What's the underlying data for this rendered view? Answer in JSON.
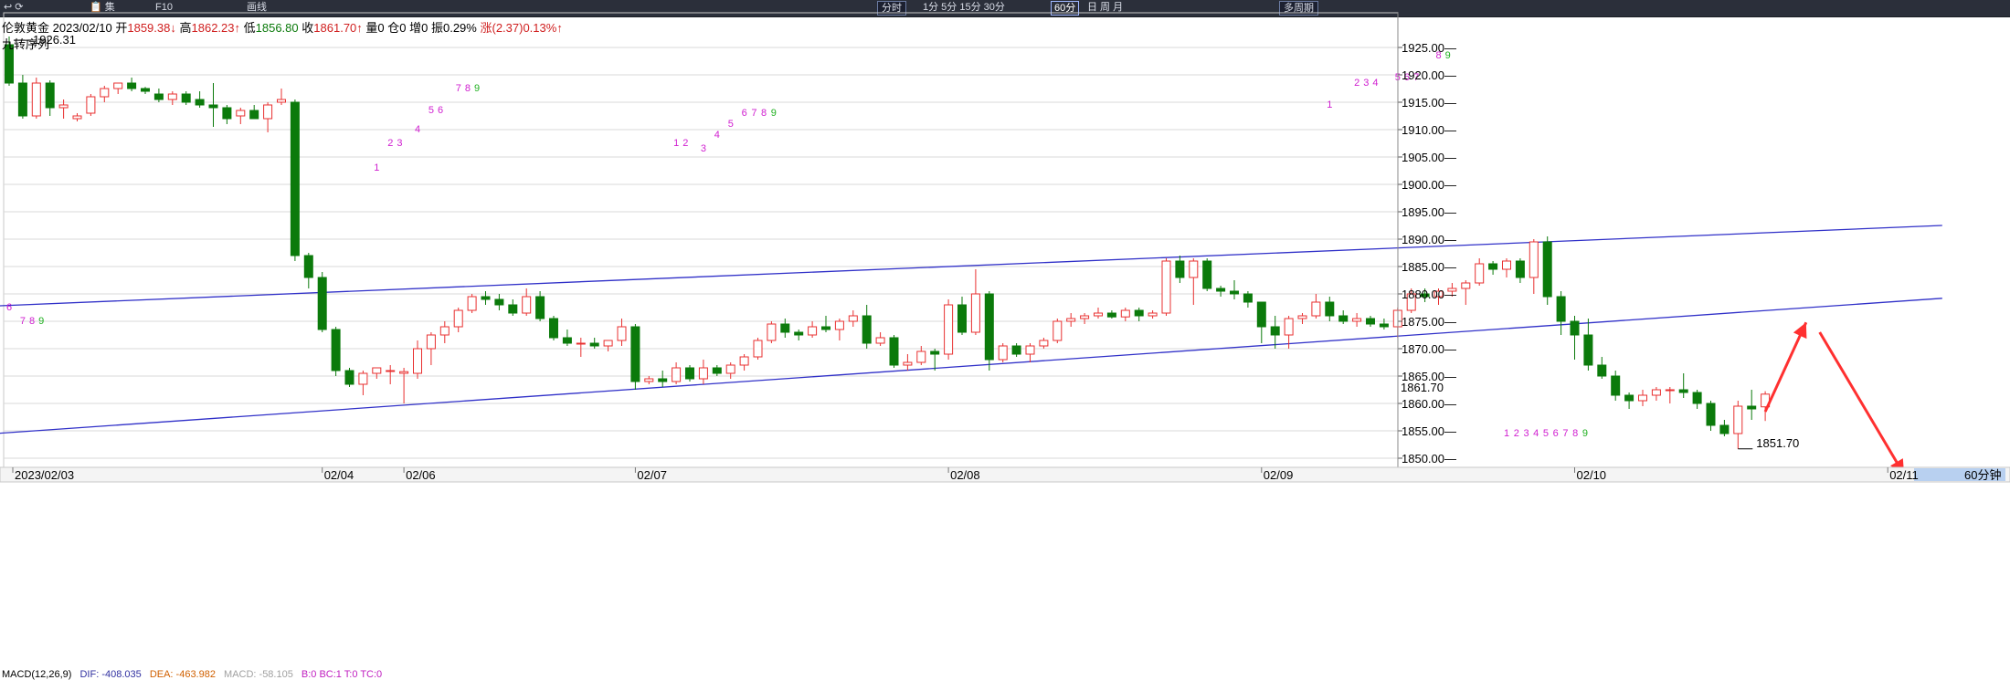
{
  "toolbar": {
    "items": [
      {
        "label": "↩ ⟳",
        "x": 4
      },
      {
        "label": "📋 集",
        "x": 98
      },
      {
        "label": "F10",
        "x": 170
      },
      {
        "label": "画线",
        "x": 270
      },
      {
        "label": "分时",
        "x": 960,
        "box": true
      },
      {
        "label": "1分 5分 15分 30分",
        "x": 1010
      },
      {
        "label": "60分",
        "x": 1150,
        "selected": true
      },
      {
        "label": "日 周 月",
        "x": 1190
      },
      {
        "label": "多周期",
        "x": 1400,
        "box": true
      }
    ]
  },
  "info": {
    "name": "伦敦黄金",
    "date": "2023/02/10",
    "open_label": "开",
    "open": "1859.38",
    "high_label": "高",
    "high": "1862.23",
    "low_label": "低",
    "low": "1856.80",
    "close_label": "收",
    "close": "1861.70",
    "vol": "量0",
    "oi": "仓0",
    "inc": "增0",
    "amp": "振0.29%",
    "chg": "涨(2.37)0.13%"
  },
  "indicator_name": "九转序列",
  "macd": {
    "params": "MACD(12,26,9)",
    "dif": "DIF: -408.035",
    "dea": "DEA: -463.982",
    "macd": "MACD: -58.105",
    "extra": "B:0  BC:1  T:0  TC:0"
  },
  "period_label": "60分钟",
  "colors": {
    "up": "#e83030",
    "down": "#0b7a0b",
    "trend_line": "#3030c8",
    "arrow": "#ff3030",
    "seq_magenta": "#d020d0",
    "seq_green": "#20b020"
  },
  "chart_data": {
    "type": "candlestick",
    "symbol": "伦敦黄金",
    "ylim": [
      1849,
      1930
    ],
    "y_ticks": [
      1850,
      1855,
      1860,
      1865,
      1870,
      1875,
      1880,
      1885,
      1890,
      1895,
      1900,
      1905,
      1910,
      1915,
      1920,
      1925
    ],
    "x_labels": [
      {
        "label": "2023/02/03",
        "bar": 0
      },
      {
        "label": "02/04",
        "bar": 23
      },
      {
        "label": "02/06",
        "bar": 29
      },
      {
        "label": "02/07",
        "bar": 46
      },
      {
        "label": "02/08",
        "bar": 69
      },
      {
        "label": "02/09",
        "bar": 92
      },
      {
        "label": "02/10",
        "bar": 115
      },
      {
        "label": "02/11",
        "bar": 138
      }
    ],
    "bar_count_total": 142,
    "candles": [
      [
        1925.5,
        1927.0,
        1918.0,
        1918.5
      ],
      [
        1918.5,
        1920.0,
        1912.0,
        1912.5
      ],
      [
        1912.5,
        1919.5,
        1912.0,
        1918.5
      ],
      [
        1918.5,
        1919.0,
        1912.5,
        1914.0
      ],
      [
        1914.0,
        1915.5,
        1912.0,
        1914.5
      ],
      [
        1912.0,
        1913.0,
        1911.5,
        1912.5
      ],
      [
        1913.0,
        1916.5,
        1912.5,
        1916.0
      ],
      [
        1916.0,
        1918.0,
        1915.0,
        1917.5
      ],
      [
        1917.5,
        1918.5,
        1916.5,
        1918.5
      ],
      [
        1918.5,
        1919.5,
        1917.0,
        1917.5
      ],
      [
        1917.5,
        1917.8,
        1916.5,
        1917.0
      ],
      [
        1916.5,
        1917.5,
        1915.0,
        1915.5
      ],
      [
        1915.5,
        1917.0,
        1914.5,
        1916.5
      ],
      [
        1916.5,
        1917.0,
        1914.5,
        1915.0
      ],
      [
        1915.5,
        1917.0,
        1914.0,
        1914.5
      ],
      [
        1914.5,
        1918.5,
        1910.5,
        1914.0
      ],
      [
        1914.0,
        1914.5,
        1911.0,
        1912.0
      ],
      [
        1912.5,
        1914.0,
        1911.0,
        1913.5
      ],
      [
        1913.5,
        1914.5,
        1912.5,
        1912.0
      ],
      [
        1912.0,
        1915.0,
        1909.5,
        1914.5
      ],
      [
        1915.0,
        1917.5,
        1914.5,
        1915.5
      ],
      [
        1915.0,
        1915.5,
        1886.0,
        1887.0
      ],
      [
        1887.0,
        1887.5,
        1881.0,
        1883.0
      ],
      [
        1883.0,
        1884.0,
        1873.0,
        1873.5
      ],
      [
        1873.5,
        1874.0,
        1865.0,
        1866.0
      ],
      [
        1866.0,
        1866.5,
        1863.0,
        1863.5
      ],
      [
        1863.5,
        1866.0,
        1861.5,
        1865.5
      ],
      [
        1865.5,
        1866.5,
        1864.5,
        1866.5
      ],
      [
        1866.0,
        1867.0,
        1863.5,
        1866.0
      ],
      [
        1865.5,
        1866.5,
        1860.0,
        1865.8
      ],
      [
        1865.5,
        1871.5,
        1864.5,
        1870.0
      ],
      [
        1870.0,
        1873.0,
        1867.0,
        1872.5
      ],
      [
        1872.5,
        1875.0,
        1871.0,
        1874.0
      ],
      [
        1874.0,
        1877.5,
        1873.0,
        1877.0
      ],
      [
        1877.0,
        1880.0,
        1876.5,
        1879.5
      ],
      [
        1879.5,
        1880.5,
        1878.0,
        1879.0
      ],
      [
        1879.0,
        1880.0,
        1877.0,
        1878.0
      ],
      [
        1878.0,
        1879.0,
        1876.0,
        1876.5
      ],
      [
        1876.5,
        1881.0,
        1876.0,
        1879.5
      ],
      [
        1879.5,
        1880.5,
        1875.0,
        1875.5
      ],
      [
        1875.5,
        1876.0,
        1871.5,
        1872.0
      ],
      [
        1872.0,
        1873.5,
        1870.5,
        1871.0
      ],
      [
        1871.0,
        1872.0,
        1868.5,
        1871.0
      ],
      [
        1871.0,
        1872.0,
        1870.0,
        1870.5
      ],
      [
        1870.5,
        1871.5,
        1869.5,
        1871.5
      ],
      [
        1871.5,
        1875.5,
        1870.5,
        1874.0
      ],
      [
        1874.0,
        1874.5,
        1862.5,
        1864.0
      ],
      [
        1864.0,
        1865.0,
        1863.5,
        1864.5
      ],
      [
        1864.5,
        1866.0,
        1863.0,
        1864.0
      ],
      [
        1864.0,
        1867.5,
        1863.5,
        1866.5
      ],
      [
        1866.5,
        1867.0,
        1864.0,
        1864.5
      ],
      [
        1864.5,
        1868.0,
        1863.5,
        1866.5
      ],
      [
        1866.5,
        1867.0,
        1865.0,
        1865.5
      ],
      [
        1865.5,
        1867.5,
        1864.5,
        1867.0
      ],
      [
        1867.0,
        1869.0,
        1866.0,
        1868.5
      ],
      [
        1868.5,
        1872.0,
        1868.0,
        1871.5
      ],
      [
        1871.5,
        1875.0,
        1871.0,
        1874.5
      ],
      [
        1874.5,
        1875.5,
        1872.0,
        1873.0
      ],
      [
        1873.0,
        1873.5,
        1871.5,
        1872.5
      ],
      [
        1872.5,
        1875.0,
        1872.0,
        1874.0
      ],
      [
        1874.0,
        1876.0,
        1873.0,
        1873.5
      ],
      [
        1873.5,
        1875.5,
        1871.5,
        1875.0
      ],
      [
        1875.0,
        1877.0,
        1874.0,
        1876.0
      ],
      [
        1876.0,
        1878.0,
        1870.0,
        1871.0
      ],
      [
        1871.0,
        1873.0,
        1870.5,
        1872.0
      ],
      [
        1872.0,
        1872.5,
        1866.5,
        1867.0
      ],
      [
        1867.0,
        1869.0,
        1866.0,
        1867.5
      ],
      [
        1867.5,
        1870.5,
        1867.0,
        1869.5
      ],
      [
        1869.5,
        1870.0,
        1866.0,
        1869.0
      ],
      [
        1869.0,
        1879.0,
        1868.0,
        1878.0
      ],
      [
        1878.0,
        1879.5,
        1872.5,
        1873.0
      ],
      [
        1873.0,
        1884.5,
        1872.5,
        1880.0
      ],
      [
        1880.0,
        1880.5,
        1866.0,
        1868.0
      ],
      [
        1868.0,
        1871.0,
        1867.5,
        1870.5
      ],
      [
        1870.5,
        1871.0,
        1868.5,
        1869.0
      ],
      [
        1869.0,
        1871.0,
        1867.5,
        1870.5
      ],
      [
        1870.5,
        1872.0,
        1870.0,
        1871.5
      ],
      [
        1871.5,
        1875.5,
        1871.0,
        1875.0
      ],
      [
        1875.0,
        1876.5,
        1874.0,
        1875.5
      ],
      [
        1875.5,
        1876.5,
        1874.5,
        1876.0
      ],
      [
        1876.0,
        1877.5,
        1875.5,
        1876.5
      ],
      [
        1876.5,
        1877.0,
        1875.5,
        1875.8
      ],
      [
        1875.8,
        1877.5,
        1875.0,
        1877.0
      ],
      [
        1877.0,
        1877.5,
        1875.0,
        1876.0
      ],
      [
        1876.0,
        1877.0,
        1875.5,
        1876.5
      ],
      [
        1876.5,
        1886.5,
        1876.0,
        1886.0
      ],
      [
        1886.0,
        1887.0,
        1882.0,
        1883.0
      ],
      [
        1883.0,
        1886.5,
        1878.0,
        1886.0
      ],
      [
        1886.0,
        1886.5,
        1880.5,
        1881.0
      ],
      [
        1881.0,
        1881.5,
        1879.5,
        1880.5
      ],
      [
        1880.5,
        1882.5,
        1879.0,
        1880.0
      ],
      [
        1880.0,
        1880.5,
        1877.5,
        1878.5
      ],
      [
        1878.5,
        1878.0,
        1871.0,
        1874.0
      ],
      [
        1874.0,
        1876.0,
        1870.0,
        1872.5
      ],
      [
        1872.5,
        1876.0,
        1870.0,
        1875.5
      ],
      [
        1875.5,
        1876.5,
        1874.5,
        1876.0
      ],
      [
        1876.0,
        1880.0,
        1875.5,
        1878.5
      ],
      [
        1878.5,
        1879.5,
        1875.0,
        1876.0
      ],
      [
        1876.0,
        1877.0,
        1874.5,
        1875.0
      ],
      [
        1875.0,
        1876.5,
        1874.0,
        1875.5
      ],
      [
        1875.5,
        1876.0,
        1874.0,
        1874.5
      ],
      [
        1874.5,
        1875.5,
        1873.5,
        1874.0
      ],
      [
        1874.0,
        1877.5,
        1872.0,
        1877.0
      ],
      [
        1877.0,
        1881.0,
        1876.5,
        1880.0
      ],
      [
        1880.0,
        1881.0,
        1878.5,
        1879.5
      ],
      [
        1879.5,
        1881.0,
        1878.0,
        1880.5
      ],
      [
        1880.5,
        1882.0,
        1879.5,
        1881.0
      ],
      [
        1881.0,
        1882.5,
        1878.0,
        1882.0
      ],
      [
        1882.0,
        1886.5,
        1881.5,
        1885.5
      ],
      [
        1885.5,
        1886.0,
        1883.5,
        1884.5
      ],
      [
        1884.5,
        1886.5,
        1883.0,
        1886.0
      ],
      [
        1886.0,
        1886.5,
        1882.0,
        1883.0
      ],
      [
        1883.0,
        1890.0,
        1880.0,
        1889.5
      ],
      [
        1889.5,
        1890.5,
        1878.0,
        1879.5
      ],
      [
        1879.5,
        1880.5,
        1872.5,
        1875.0
      ],
      [
        1875.0,
        1876.0,
        1868.0,
        1872.5
      ],
      [
        1872.5,
        1875.5,
        1866.0,
        1867.0
      ],
      [
        1867.0,
        1868.5,
        1864.5,
        1865.0
      ],
      [
        1865.0,
        1866.0,
        1860.5,
        1861.5
      ],
      [
        1861.5,
        1862.0,
        1859.0,
        1860.5
      ],
      [
        1860.5,
        1862.5,
        1859.5,
        1861.5
      ],
      [
        1861.5,
        1863.0,
        1860.5,
        1862.5
      ],
      [
        1862.5,
        1863.0,
        1860.0,
        1862.5
      ],
      [
        1862.5,
        1865.5,
        1861.0,
        1862.0
      ],
      [
        1862.0,
        1862.5,
        1859.0,
        1860.0
      ],
      [
        1860.0,
        1860.5,
        1855.0,
        1856.0
      ],
      [
        1856.0,
        1857.0,
        1854.0,
        1854.5
      ],
      [
        1854.5,
        1860.5,
        1851.7,
        1859.5
      ],
      [
        1859.5,
        1862.5,
        1857.0,
        1859.0
      ],
      [
        1859.38,
        1862.23,
        1856.8,
        1861.7
      ]
    ],
    "annotations": {
      "max": {
        "bar": 0,
        "value": 1926.31
      },
      "min": {
        "bar": 127,
        "value": 1851.7
      },
      "last": {
        "value": 1861.7
      }
    },
    "trend_lines": [
      {
        "from": {
          "bar": -1,
          "value": 1877.8
        },
        "to": {
          "bar": 142,
          "value": 1892.5
        }
      },
      {
        "from": {
          "bar": -1,
          "value": 1854.5
        },
        "to": {
          "bar": 142,
          "value": 1879.2
        }
      }
    ],
    "projection_arrows": [
      {
        "from": {
          "bar": 129,
          "value": 1858.5
        },
        "to": {
          "bar": 132,
          "value": 1874.8
        }
      },
      {
        "from": {
          "bar": 133,
          "value": 1873.0
        },
        "to": {
          "bar": 139.2,
          "value": 1847.0
        }
      }
    ],
    "td_sequential": [
      {
        "bar": 0,
        "value": 1877.0,
        "labels": [
          "6"
        ]
      },
      {
        "bar": 1,
        "value": 1874.5,
        "labels": [
          "7",
          "8",
          "9"
        ]
      },
      {
        "bar": 27,
        "value": 1902.5,
        "labels": [
          "1"
        ]
      },
      {
        "bar": 28,
        "value": 1907.0,
        "labels": [
          "2",
          "3"
        ]
      },
      {
        "bar": 30,
        "value": 1909.5,
        "labels": [
          "4"
        ]
      },
      {
        "bar": 31,
        "value": 1913.0,
        "labels": [
          "5",
          "6"
        ]
      },
      {
        "bar": 33,
        "value": 1917.0,
        "labels": [
          "7",
          "8",
          "9"
        ]
      },
      {
        "bar": 49,
        "value": 1907.0,
        "labels": [
          "1",
          "2"
        ]
      },
      {
        "bar": 51,
        "value": 1906.0,
        "labels": [
          "3"
        ]
      },
      {
        "bar": 52,
        "value": 1908.5,
        "labels": [
          "4"
        ]
      },
      {
        "bar": 53,
        "value": 1910.5,
        "labels": [
          "5"
        ]
      },
      {
        "bar": 54,
        "value": 1912.5,
        "labels": [
          "6",
          "7",
          "8",
          "9"
        ]
      },
      {
        "bar": 97,
        "value": 1914.0,
        "labels": [
          "1"
        ]
      },
      {
        "bar": 99,
        "value": 1918.0,
        "labels": [
          "2",
          "3",
          "4"
        ]
      },
      {
        "bar": 102,
        "value": 1919.0,
        "labels": [
          "5",
          "6",
          "7"
        ]
      },
      {
        "bar": 105,
        "value": 1923.0,
        "labels": [
          "8",
          "9"
        ]
      },
      {
        "bar": 110,
        "value": 1854.0,
        "labels": [
          "1",
          "2",
          "3",
          "4",
          "5",
          "6",
          "7",
          "8",
          "9"
        ]
      }
    ]
  }
}
